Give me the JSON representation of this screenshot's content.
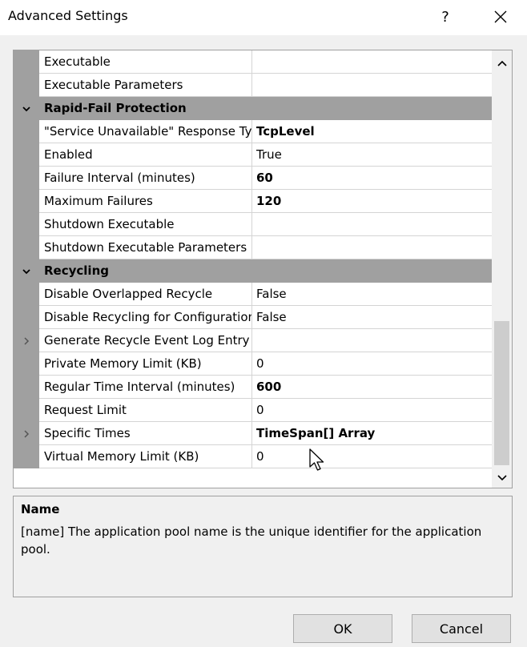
{
  "window": {
    "title": "Advanced Settings",
    "help_label": "?",
    "close_icon": "close-icon"
  },
  "grid": {
    "rows": [
      {
        "type": "property",
        "name": "Executable",
        "value": "",
        "bold": false,
        "expander": false
      },
      {
        "type": "property",
        "name": "Executable Parameters",
        "value": "",
        "bold": false,
        "expander": false
      },
      {
        "type": "category",
        "name": "Rapid-Fail Protection",
        "expanded": true
      },
      {
        "type": "property",
        "name": "\"Service Unavailable\" Response Type",
        "value": "TcpLevel",
        "bold": true,
        "expander": false
      },
      {
        "type": "property",
        "name": "Enabled",
        "value": "True",
        "bold": false,
        "expander": false
      },
      {
        "type": "property",
        "name": "Failure Interval (minutes)",
        "value": "60",
        "bold": true,
        "expander": false
      },
      {
        "type": "property",
        "name": "Maximum Failures",
        "value": "120",
        "bold": true,
        "expander": false
      },
      {
        "type": "property",
        "name": "Shutdown Executable",
        "value": "",
        "bold": false,
        "expander": false
      },
      {
        "type": "property",
        "name": "Shutdown Executable Parameters",
        "value": "",
        "bold": false,
        "expander": false
      },
      {
        "type": "category",
        "name": "Recycling",
        "expanded": true
      },
      {
        "type": "property",
        "name": "Disable Overlapped Recycle",
        "value": "False",
        "bold": false,
        "expander": false
      },
      {
        "type": "property",
        "name": "Disable Recycling for Configuration Changes",
        "value": "False",
        "bold": false,
        "expander": false
      },
      {
        "type": "property",
        "name": "Generate Recycle Event Log Entry",
        "value": "",
        "bold": false,
        "expander": true
      },
      {
        "type": "property",
        "name": "Private Memory Limit (KB)",
        "value": "0",
        "bold": false,
        "expander": false
      },
      {
        "type": "property",
        "name": "Regular Time Interval (minutes)",
        "value": "600",
        "bold": true,
        "expander": false
      },
      {
        "type": "property",
        "name": "Request Limit",
        "value": "0",
        "bold": false,
        "expander": false
      },
      {
        "type": "property",
        "name": "Specific Times",
        "value": "TimeSpan[] Array",
        "bold": true,
        "expander": true
      },
      {
        "type": "property",
        "name": "Virtual Memory Limit (KB)",
        "value": "0",
        "bold": false,
        "expander": false
      }
    ]
  },
  "description": {
    "title": "Name",
    "text": "[name] The application pool name is the unique identifier for the application pool."
  },
  "buttons": {
    "ok_label": "OK",
    "cancel_label": "Cancel"
  },
  "colors": {
    "category_band": "#a0a0a0",
    "grid_line": "#d4d4d4",
    "dialog_bg": "#f0f0f0"
  }
}
